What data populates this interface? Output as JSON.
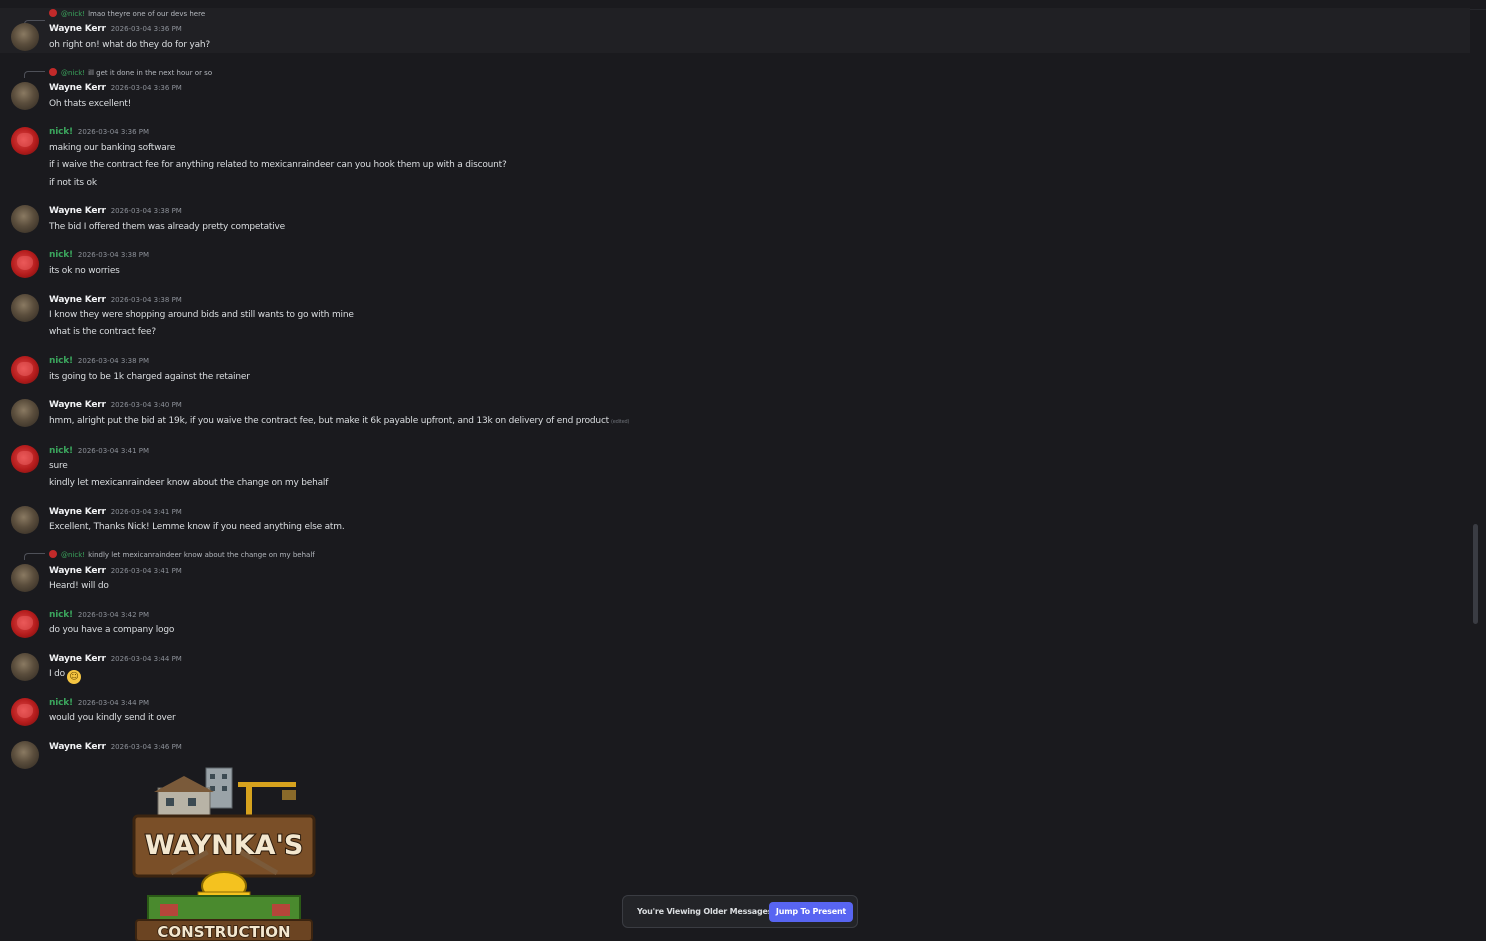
{
  "messages": [
    {
      "author": "Wayne Kerr",
      "author_class": "wayne",
      "timestamp": "2026-03-04 3:36 PM",
      "highlighted": true,
      "reply": {
        "mention": "@nick!",
        "text": "lmao theyre one of our devs here"
      },
      "lines": [
        "oh right on! what do they do for yah?"
      ]
    },
    {
      "author": "Wayne Kerr",
      "author_class": "wayne",
      "timestamp": "2026-03-04 3:36 PM",
      "reply": {
        "mention": "@nick!",
        "text": "ill get it done in the next hour or so"
      },
      "lines": [
        "Oh thats excellent!"
      ]
    },
    {
      "author": "nick!",
      "author_class": "nick",
      "timestamp": "2026-03-04 3:36 PM",
      "lines": [
        "making our banking software",
        "if i waive the contract fee for anything related to mexicanraindeer can you hook them up with a discount?",
        "if not its ok"
      ]
    },
    {
      "author": "Wayne Kerr",
      "author_class": "wayne",
      "timestamp": "2026-03-04 3:38 PM",
      "lines": [
        "The bid I offered them was already pretty competative"
      ]
    },
    {
      "author": "nick!",
      "author_class": "nick",
      "timestamp": "2026-03-04 3:38 PM",
      "lines": [
        "its ok no worries"
      ]
    },
    {
      "author": "Wayne Kerr",
      "author_class": "wayne",
      "timestamp": "2026-03-04 3:38 PM",
      "lines": [
        "I know they were shopping around bids and still wants to go with mine",
        "what is the contract fee?"
      ]
    },
    {
      "author": "nick!",
      "author_class": "nick",
      "timestamp": "2026-03-04 3:38 PM",
      "lines": [
        "its going to be 1k charged against the retainer"
      ]
    },
    {
      "author": "Wayne Kerr",
      "author_class": "wayne",
      "timestamp": "2026-03-04 3:40 PM",
      "lines": [
        "hmm, alright put the bid at 19k, if you waive the contract fee, but make it 6k payable upfront, and 13k on delivery of end product"
      ],
      "edited": "(edited)"
    },
    {
      "author": "nick!",
      "author_class": "nick",
      "timestamp": "2026-03-04 3:41 PM",
      "lines": [
        "sure",
        "kindly let mexicanraindeer know about the change on my behalf"
      ]
    },
    {
      "author": "Wayne Kerr",
      "author_class": "wayne",
      "timestamp": "2026-03-04 3:41 PM",
      "lines": [
        "Excellent, Thanks Nick! Lemme know if you need anything else atm."
      ]
    },
    {
      "author": "Wayne Kerr",
      "author_class": "wayne",
      "timestamp": "2026-03-04 3:41 PM",
      "reply": {
        "mention": "@nick!",
        "text": "kindly let mexicanraindeer know about the change on my behalf"
      },
      "lines": [
        "Heard! will do"
      ]
    },
    {
      "author": "nick!",
      "author_class": "nick",
      "timestamp": "2026-03-04 3:42 PM",
      "lines": [
        "do you have a company logo"
      ]
    },
    {
      "author": "Wayne Kerr",
      "author_class": "wayne",
      "timestamp": "2026-03-04 3:44 PM",
      "lines": [
        "I do"
      ],
      "emoji": "slight-smile-emoji"
    },
    {
      "author": "nick!",
      "author_class": "nick",
      "timestamp": "2026-03-04 3:44 PM",
      "lines": [
        "would you kindly send it over"
      ]
    },
    {
      "author": "Wayne Kerr",
      "author_class": "wayne",
      "timestamp": "2026-03-04 3:46 PM",
      "lines": [],
      "attachment": "company-logo-image"
    }
  ],
  "attachment_logo": {
    "top_text": "WAYNKA'S",
    "bottom_text": "CONSTRUCTION"
  },
  "jump_bar": {
    "viewing_text": "You're Viewing Older Messages",
    "button_label": "Jump To Present"
  },
  "colors": {
    "background": "#1a1a1e",
    "nick_name": "#3ba55d",
    "jump_button": "#5865f2"
  }
}
